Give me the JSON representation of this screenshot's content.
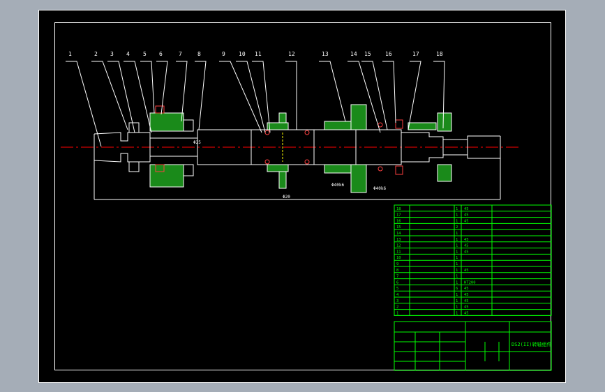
{
  "drawing": {
    "background": "#000000",
    "line_color": "#ffffff",
    "frame_color": "#ffffff",
    "table_color": "#00ff00",
    "centerline_color": "#ff0000",
    "section_fill": "#1a8a1a",
    "hidden_line_color": "#ffff00",
    "balloons": [
      "1",
      "2",
      "3",
      "4",
      "5",
      "6",
      "7",
      "8",
      "9",
      "10",
      "11",
      "12",
      "13",
      "14",
      "15",
      "16",
      "17",
      "18"
    ],
    "dimensions": [
      {
        "text": "Φ40k6"
      },
      {
        "text": "Φ40k6"
      },
      {
        "text": "Φ20"
      },
      {
        "text": "Φ25"
      }
    ]
  },
  "bom": {
    "rows": [
      {
        "no": "18",
        "qty": "1",
        "material": "45"
      },
      {
        "no": "17",
        "qty": "1",
        "material": "45"
      },
      {
        "no": "16",
        "qty": "1",
        "material": "45"
      },
      {
        "no": "15",
        "qty": "2",
        "material": ""
      },
      {
        "no": "14",
        "qty": "1",
        "material": ""
      },
      {
        "no": "13",
        "qty": "1",
        "material": "45"
      },
      {
        "no": "12",
        "qty": "1",
        "material": "45"
      },
      {
        "no": "11",
        "qty": "1",
        "material": "45"
      },
      {
        "no": "10",
        "qty": "1",
        "material": ""
      },
      {
        "no": "9",
        "qty": "1",
        "material": ""
      },
      {
        "no": "8",
        "qty": "1",
        "material": "45"
      },
      {
        "no": "7",
        "qty": "1",
        "material": ""
      },
      {
        "no": "6",
        "qty": "1",
        "material": "HT200"
      },
      {
        "no": "5",
        "qty": "6",
        "material": "45"
      },
      {
        "no": "4",
        "qty": "1",
        "material": "45"
      },
      {
        "no": "3",
        "qty": "1",
        "material": "45"
      },
      {
        "no": "2",
        "qty": "1",
        "material": "45"
      },
      {
        "no": "1",
        "qty": "1",
        "material": "45"
      }
    ]
  },
  "title_block": {
    "drawing_title": "DS2(II)转轴组件"
  }
}
